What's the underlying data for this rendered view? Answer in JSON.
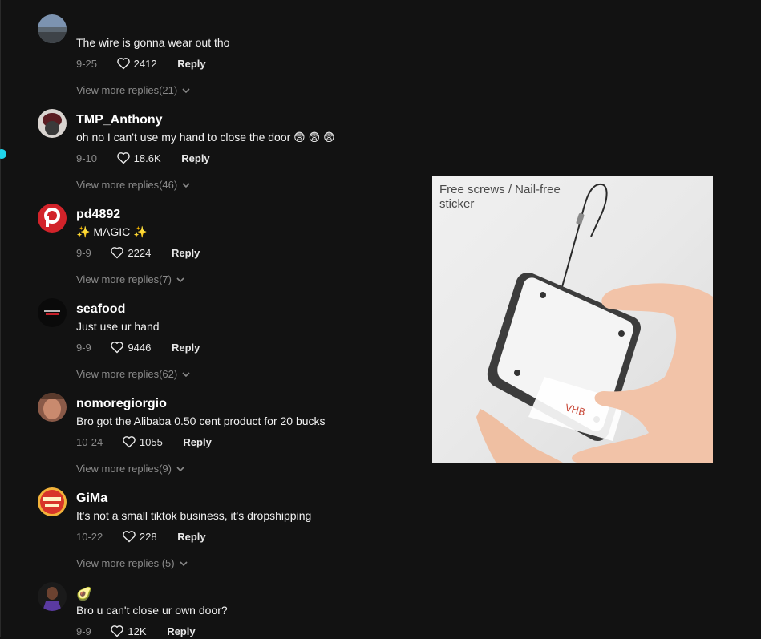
{
  "colors": {
    "background": "#121212",
    "meta_text": "#8a8a8a",
    "verified": "#20d5ec"
  },
  "icons": {
    "like": "heart-outline-icon",
    "expand": "chevron-down-icon",
    "verified": "verified-check-icon"
  },
  "top_partial_text": "",
  "comments": [
    {
      "username": "",
      "text": "The wire is gonna wear out tho",
      "date": "9-25",
      "likes": "2412",
      "reply_label": "Reply",
      "more_replies": "View more replies(21)"
    },
    {
      "username": "TMP_Anthony",
      "text": "oh no I can't use my hand to close the door 😨 😨 😨",
      "date": "9-10",
      "likes": "18.6K",
      "reply_label": "Reply",
      "more_replies": "View more replies(46)"
    },
    {
      "username": "pd4892",
      "text_sparkle_left": "✨",
      "text_main": " MAGIC ",
      "text_sparkle_right": "✨",
      "date": "9-9",
      "likes": "2224",
      "reply_label": "Reply",
      "more_replies": "View more replies(7)"
    },
    {
      "username": "seafood",
      "text": "Just use ur hand",
      "date": "9-9",
      "likes": "9446",
      "reply_label": "Reply",
      "more_replies": "View more replies(62)"
    },
    {
      "username": "nomoregiorgio",
      "text": "Bro got the Alibaba 0.50 cent product for 20 bucks",
      "date": "10-24",
      "likes": "1055",
      "reply_label": "Reply",
      "more_replies": "View more replies(9)"
    },
    {
      "username": "GiMa",
      "text": "It's not a small tiktok business, it's dropshipping",
      "date": "10-22",
      "likes": "228",
      "reply_label": "Reply",
      "more_replies": "View more replies (5)"
    },
    {
      "username": "🥑",
      "text": "Bro u can't close ur own door?",
      "date": "9-9",
      "likes": "12K",
      "reply_label": "Reply",
      "more_replies": ""
    }
  ],
  "product_image": {
    "caption_line1": "Free screws / Nail-free",
    "caption_line2": "sticker"
  }
}
